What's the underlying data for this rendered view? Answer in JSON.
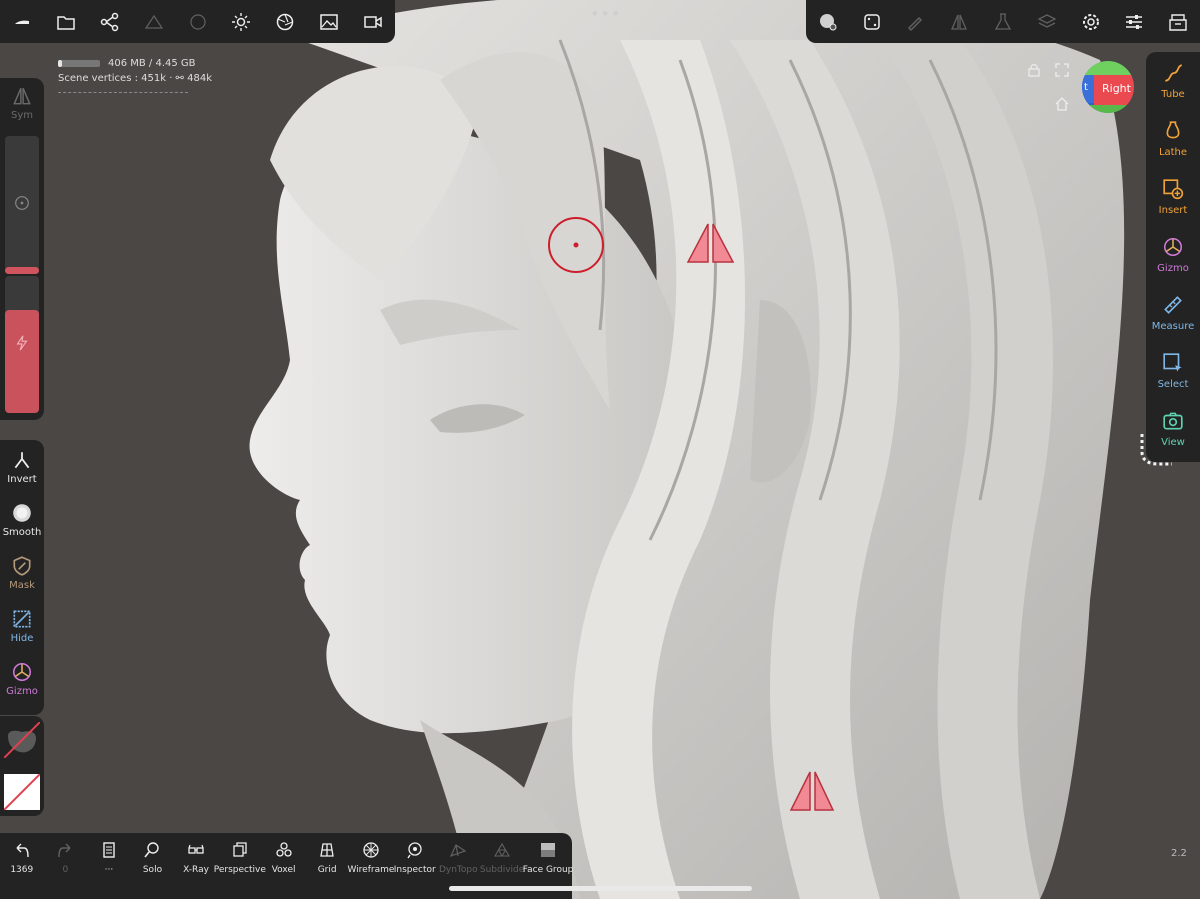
{
  "top_toolbar": {
    "left_icons": [
      "menu-icon",
      "folder-icon",
      "scene-graph-icon",
      "topology-icon",
      "matcap-icon",
      "light-icon",
      "camera-lens-icon",
      "image-icon",
      "video-icon"
    ],
    "right_icons": [
      "material-icon",
      "dice-icon",
      "brush-icon",
      "symmetry-icon",
      "flask-icon",
      "layers-icon",
      "gear-icon",
      "sliders-icon",
      "store-icon"
    ]
  },
  "info": {
    "memory": "406 MB / 4.45 GB",
    "memory_used_fraction": 0.09,
    "vertices": "Scene vertices : 451k · ⚯ 484k"
  },
  "left_toolbar": {
    "sym": "Sym",
    "tools": [
      {
        "label": "Invert",
        "color": "#e8e8e8"
      },
      {
        "label": "Smooth",
        "color": "#e8e8e8"
      },
      {
        "label": "Mask",
        "color": "#b59a7a"
      },
      {
        "label": "Hide",
        "color": "#7fb6e6"
      },
      {
        "label": "Gizmo",
        "color": "#d07ad8"
      }
    ],
    "radius_slider_fraction": 0.05,
    "intensity_slider_fraction": 0.75
  },
  "right_toolbar": {
    "tools": [
      {
        "label": "Tube",
        "color": "#f0a23a"
      },
      {
        "label": "Lathe",
        "color": "#f0a23a"
      },
      {
        "label": "Insert",
        "color": "#f0a23a"
      },
      {
        "label": "Gizmo",
        "color": "#d07ad8"
      },
      {
        "label": "Measure",
        "color": "#7fb6e6"
      },
      {
        "label": "Select",
        "color": "#7fb6e6"
      },
      {
        "label": "View",
        "color": "#5fd3b0"
      }
    ]
  },
  "gizmo": {
    "label": "Right",
    "left_label": "t"
  },
  "bottom_toolbar": {
    "items": [
      {
        "label": "1369",
        "icon": "undo-icon"
      },
      {
        "label": "0",
        "icon": "redo-icon"
      },
      {
        "label": "···",
        "icon": "notebook-icon"
      },
      {
        "label": "Solo",
        "icon": "solo-icon"
      },
      {
        "label": "X-Ray",
        "icon": "xray-icon"
      },
      {
        "label": "Perspective",
        "icon": "perspective-icon"
      },
      {
        "label": "Voxel",
        "icon": "voxel-icon"
      },
      {
        "label": "Grid",
        "icon": "grid-icon"
      },
      {
        "label": "Wireframe",
        "icon": "wireframe-icon"
      },
      {
        "label": "Inspector",
        "icon": "inspector-icon"
      },
      {
        "label": "DynTopo",
        "icon": "dyntopo-icon"
      },
      {
        "label": "Subdivide",
        "icon": "subdivide-icon"
      },
      {
        "label": "Face Group",
        "icon": "face-group-icon"
      }
    ]
  },
  "zoom_value": "2.2",
  "colors": {
    "accent_red": "#e0404f",
    "panel": "#232323",
    "background": "#4a4745",
    "model": "#d9d7d4"
  }
}
